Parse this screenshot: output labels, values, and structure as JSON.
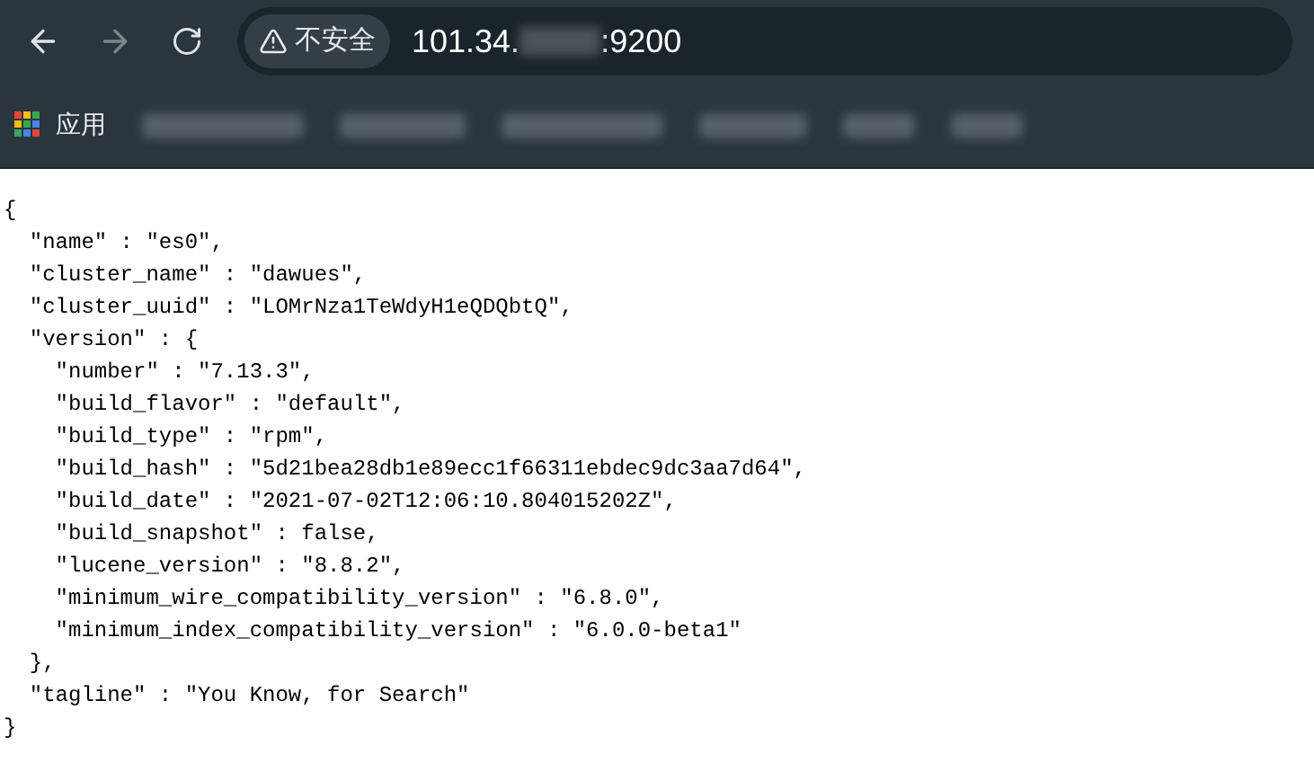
{
  "toolbar": {
    "security_label": "不安全",
    "address_start": "101.34.",
    "address_end": ":9200"
  },
  "bookmarks_bar": {
    "apps_label": "应用"
  },
  "body_lines": [
    "{",
    "  \"name\" : \"es0\",",
    "  \"cluster_name\" : \"dawues\",",
    "  \"cluster_uuid\" : \"LOMrNza1TeWdyH1eQDQbtQ\",",
    "  \"version\" : {",
    "    \"number\" : \"7.13.3\",",
    "    \"build_flavor\" : \"default\",",
    "    \"build_type\" : \"rpm\",",
    "    \"build_hash\" : \"5d21bea28db1e89ecc1f66311ebdec9dc3aa7d64\",",
    "    \"build_date\" : \"2021-07-02T12:06:10.804015202Z\",",
    "    \"build_snapshot\" : false,",
    "    \"lucene_version\" : \"8.8.2\",",
    "    \"minimum_wire_compatibility_version\" : \"6.8.0\",",
    "    \"minimum_index_compatibility_version\" : \"6.0.0-beta1\"",
    "  },",
    "  \"tagline\" : \"You Know, for Search\"",
    "}"
  ]
}
